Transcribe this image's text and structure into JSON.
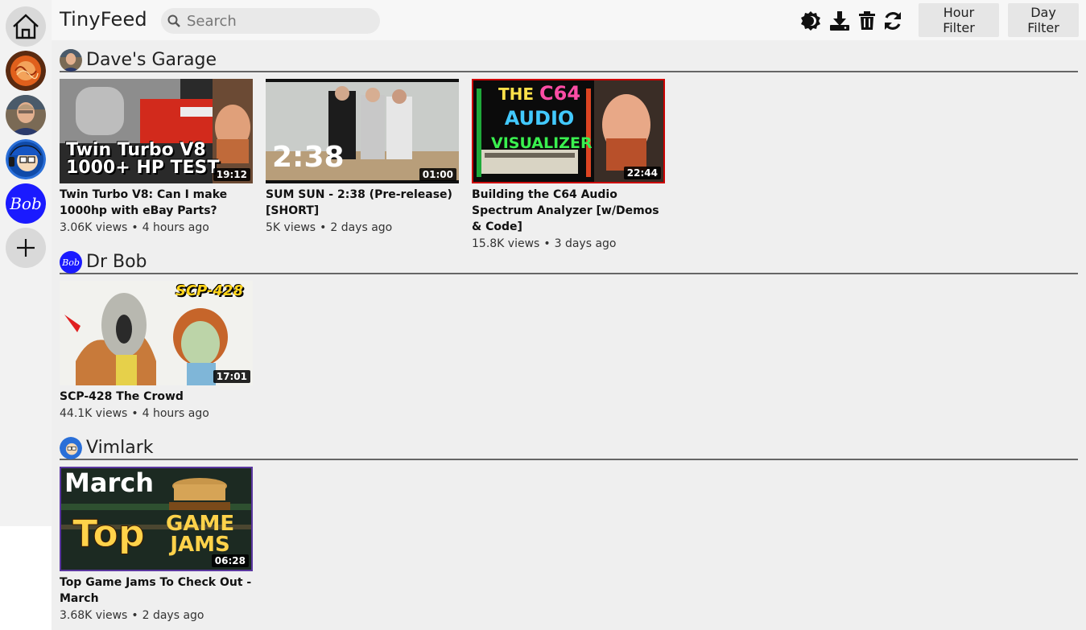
{
  "app": {
    "title": "TinyFeed"
  },
  "search": {
    "placeholder": "Search"
  },
  "toolbar": {
    "icons": [
      "theme-icon",
      "download-icon",
      "trash-icon",
      "refresh-icon"
    ],
    "hour_filter": "Hour Filter",
    "day_filter": "Day Filter"
  },
  "rail": {
    "items": [
      "home-icon",
      "avatar-orange",
      "avatar-dave",
      "avatar-vimlark",
      "avatar-bob",
      "add-icon"
    ],
    "bob_text": "Bob"
  },
  "sections": [
    {
      "channel": "Dave's Garage",
      "videos": [
        {
          "title": "Twin Turbo V8: Can I make 1000hp with eBay Parts?",
          "views": "3.06K views",
          "age": "4 hours ago",
          "duration": "19:12",
          "thumb_text": "Twin Turbo V8\n1000+ HP TEST"
        },
        {
          "title": "SUM SUN - 2:38 (Pre-release) [SHORT]",
          "views": "5K views",
          "age": "2 days ago",
          "duration": "01:00",
          "thumb_text": "2:38"
        },
        {
          "title": "Building the C64 Audio Spectrum Analyzer [w/Demos & Code]",
          "views": "15.8K views",
          "age": "3 days ago",
          "duration": "22:44",
          "thumb_text": "THE C64 AUDIO VISUALIZER"
        }
      ]
    },
    {
      "channel": "Dr Bob",
      "avatar_text": "Bob",
      "videos": [
        {
          "title": "SCP-428 The Crowd",
          "views": "44.1K views",
          "age": "4 hours ago",
          "duration": "17:01",
          "thumb_text": "SCP-428"
        }
      ]
    },
    {
      "channel": "Vimlark",
      "videos": [
        {
          "title": "Top Game Jams To Check Out - March",
          "views": "3.68K views",
          "age": "2 days ago",
          "duration": "06:28",
          "thumb_text": "March Top GAME JAMS"
        }
      ]
    }
  ],
  "colors": {
    "rail_bg": "#f2f2f2",
    "main_bg": "#efefef",
    "bob_blue": "#1a1aff"
  }
}
